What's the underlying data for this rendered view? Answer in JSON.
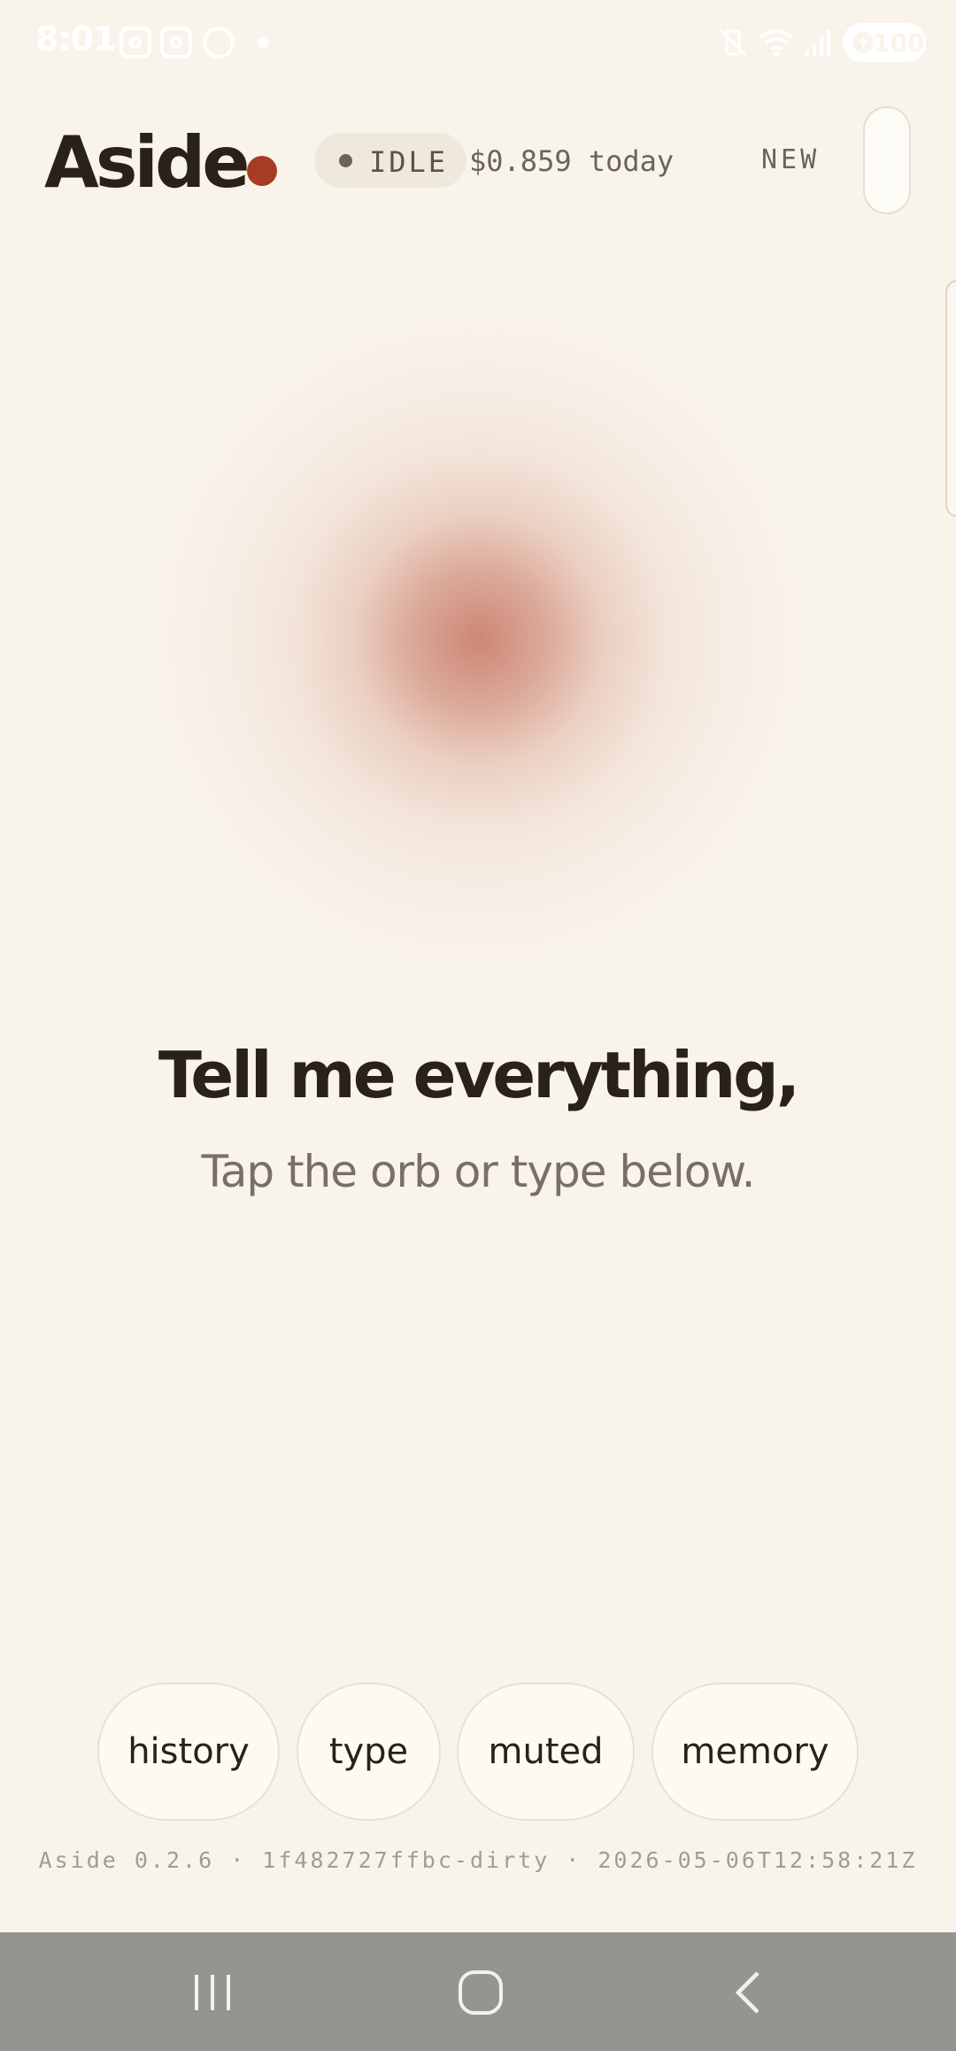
{
  "status_bar": {
    "time": "8:01",
    "battery": "100",
    "notification_icons": [
      "instagram-icon",
      "instagram-icon",
      "whatsapp-icon",
      "dot-icon"
    ],
    "system_icons": [
      "vibrate-mute-icon",
      "wifi-icon",
      "signal-icon",
      "battery-charging-icon"
    ]
  },
  "header": {
    "title": "Aside",
    "status_label": "IDLE",
    "cost_label": "$0.859 today",
    "new_label": "NEW"
  },
  "prompt": {
    "title": "Tell me everything,",
    "subtitle": "Tap the orb or type below."
  },
  "actions": [
    {
      "label": "history"
    },
    {
      "label": "type"
    },
    {
      "label": "muted"
    },
    {
      "label": "memory"
    }
  ],
  "build_info": "Aside 0.2.6 · 1f482727ffbc-dirty · 2026-05-06T12:58:21Z",
  "nav": [
    "recent-apps-icon",
    "home-icon",
    "back-icon"
  ],
  "colors": {
    "background": "#f8f4ec",
    "accent": "#a63c24",
    "text": "#2a2118",
    "muted_text": "#7a6f64",
    "orb": "#cc806e"
  }
}
